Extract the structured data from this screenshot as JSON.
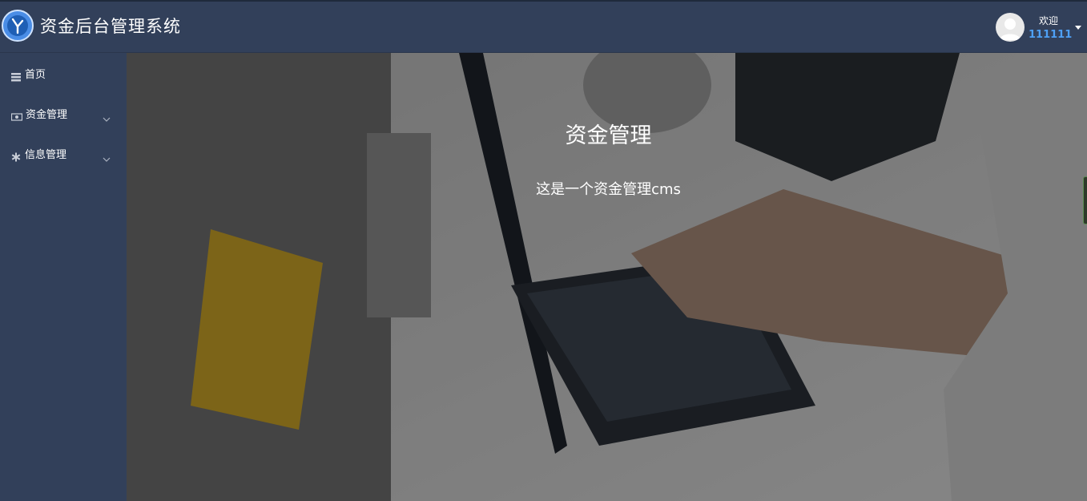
{
  "header": {
    "logo_icon": "clock-logo-icon",
    "title": "资金后台管理系统",
    "user": {
      "avatar_icon": "user-avatar-icon",
      "welcome": "欢迎",
      "username": "111111",
      "dropdown_icon": "caret-down-icon"
    }
  },
  "sidebar": {
    "items": [
      {
        "label": "首页",
        "icon": "list-icon",
        "expandable": false
      },
      {
        "label": "资金管理",
        "icon": "money-icon",
        "expandable": true
      },
      {
        "label": "信息管理",
        "icon": "asterisk-icon",
        "expandable": true
      }
    ]
  },
  "main": {
    "title": "资金管理",
    "subtitle": "这是一个资金管理cms",
    "background": "photo of hands typing on laptop keyboard"
  },
  "colors": {
    "header_bg": "#32405a",
    "sidebar_bg": "#32405a",
    "username": "#4ea0f5",
    "logo": "#4a8de6"
  }
}
